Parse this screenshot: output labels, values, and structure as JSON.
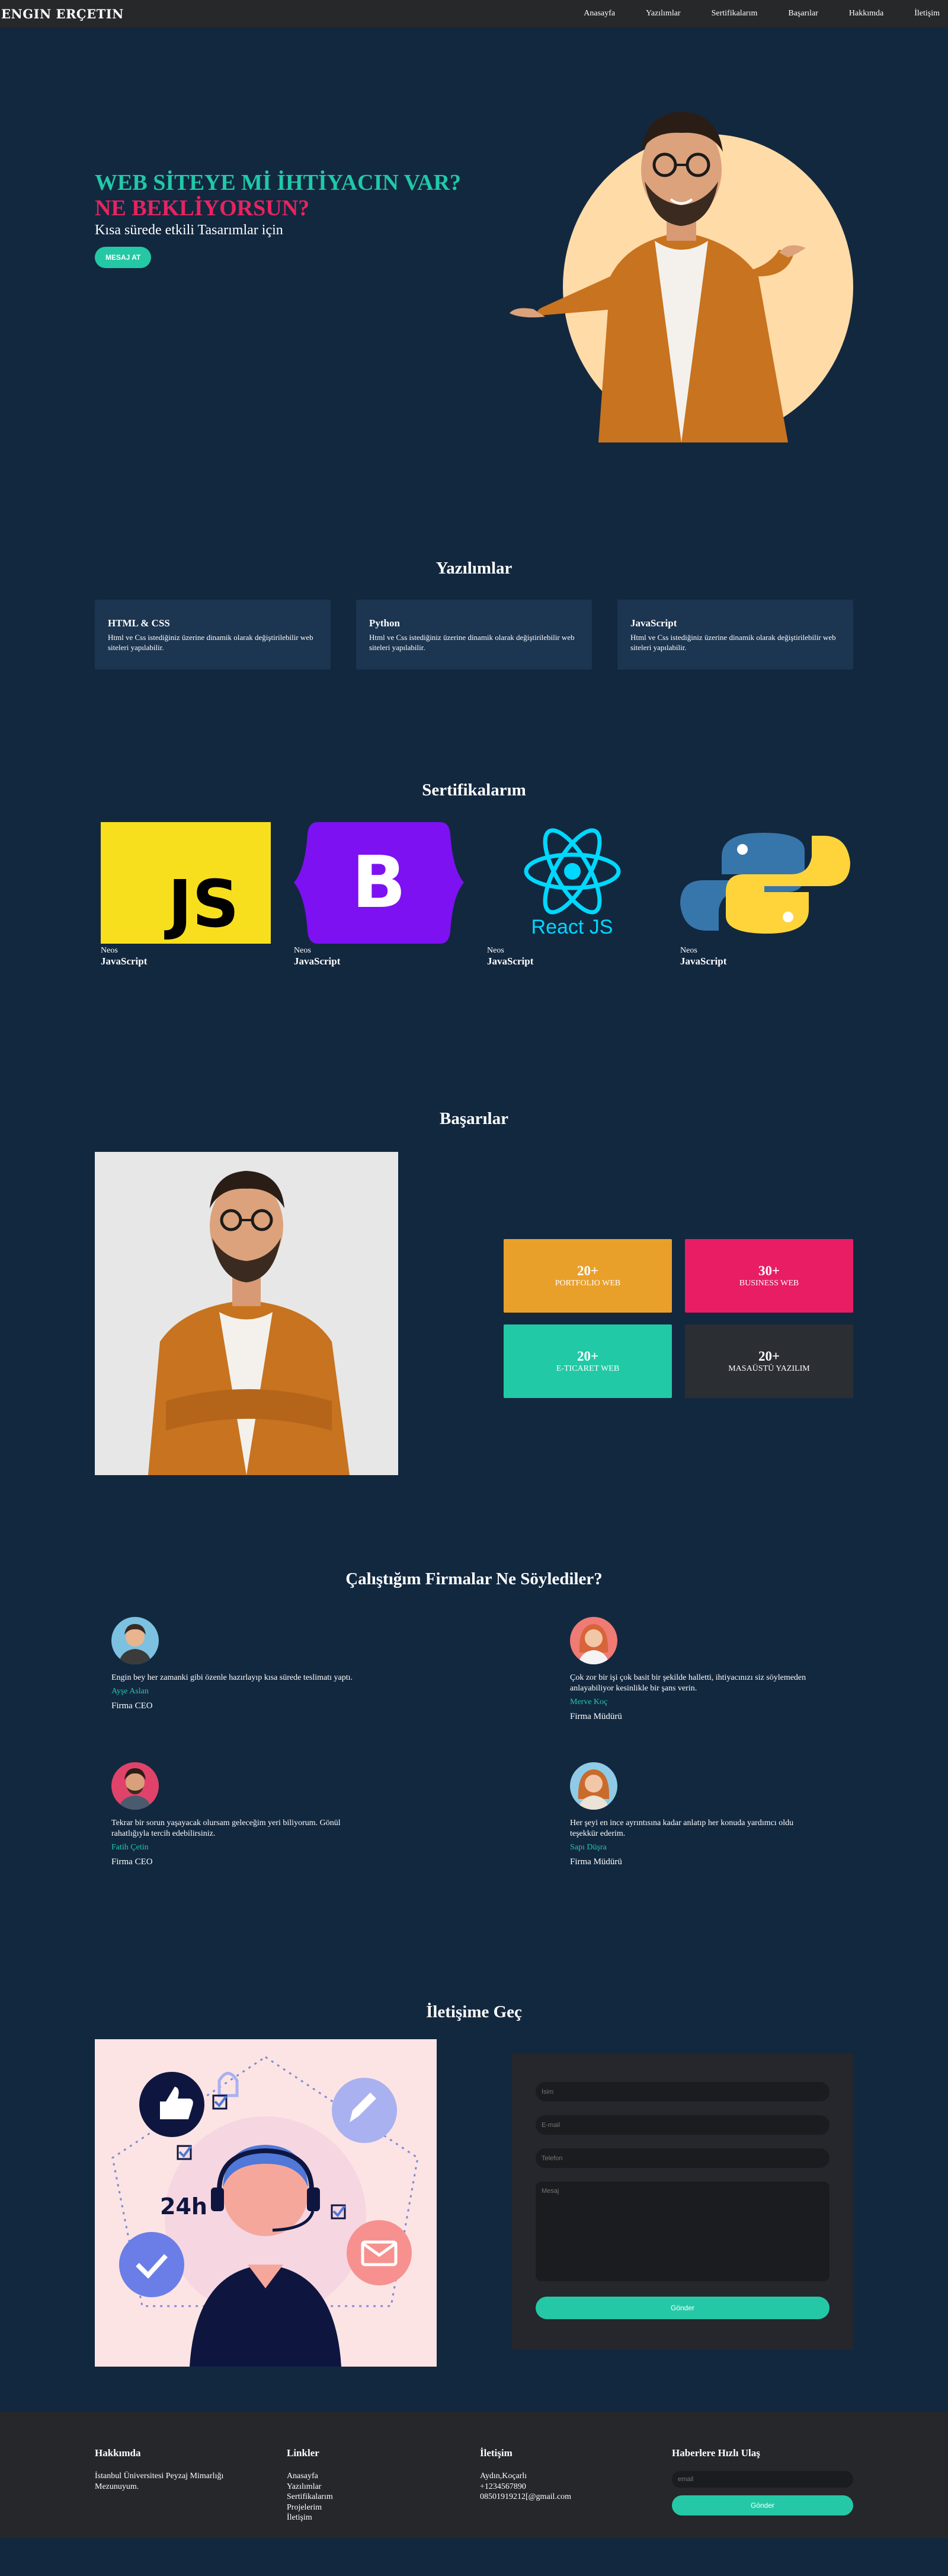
{
  "nav": {
    "brand": "ENGIN ERÇETIN",
    "links": [
      "Anasayfa",
      "Yazılımlar",
      "Sertifikalarım",
      "Başarılar",
      "Hakkımda",
      "İletişim"
    ]
  },
  "hero": {
    "line1": "WEB SİTEYE Mİ İHTİYACIN VAR?",
    "line2": "NE BEKLİYORSUN?",
    "subtitle": "Kısa sürede etkili Tasarımlar için",
    "button": "MESAJ AT"
  },
  "software": {
    "title": "Yazılımlar",
    "cards": [
      {
        "title": "HTML & CSS",
        "text": "Html ve Css istediğiniz üzerine dinamik olarak değiştirilebilir web siteleri yapılabilir."
      },
      {
        "title": "Python",
        "text": "Html ve Css istediğiniz üzerine dinamik olarak değiştirilebilir web siteleri yapılabilir."
      },
      {
        "title": "JavaScript",
        "text": "Html ve Css istediğiniz üzerine dinamik olarak değiştirilebilir web siteleri yapılabilir."
      }
    ]
  },
  "certificates": {
    "title": "Sertifikalarım",
    "items": [
      {
        "logo": "javascript-logo",
        "logo_text": "JS",
        "sub": "Neos",
        "name": "JavaScript"
      },
      {
        "logo": "bootstrap-logo",
        "logo_text": "B",
        "sub": "Neos",
        "name": "JavaScript"
      },
      {
        "logo": "react-logo",
        "logo_text": "React JS",
        "sub": "Neos",
        "name": "JavaScript"
      },
      {
        "logo": "python-logo",
        "logo_text": "",
        "sub": "Neos",
        "name": "JavaScript"
      }
    ]
  },
  "success": {
    "title": "Başarılar",
    "stats": [
      {
        "num": "20+",
        "label": "PORTFOLIO WEB",
        "color": "#e9a02a"
      },
      {
        "num": "30+",
        "label": "BUSINESS WEB",
        "color": "#e81d63"
      },
      {
        "num": "20+",
        "label": "E-TICARET WEB",
        "color": "#22c9a6"
      },
      {
        "num": "20+",
        "label": "MASAÜSTÜ YAZILIM",
        "color": "#2b2e33"
      }
    ]
  },
  "testimonials": {
    "title": "Çalıştığım Firmalar Ne Söylediler?",
    "items": [
      {
        "quote": "Engin bey her zamanki gibi özenle hazırlayıp kısa sürede teslimatı yaptı.",
        "name": "Ayşe Aslan",
        "role": "Firma CEO",
        "avatar_bg": "#7cc1e0"
      },
      {
        "quote": "Çok zor bir işi çok basit bir şekilde halletti, ihtiyacınızı siz söylemeden anlayabiliyor kesinlikle bir şans verin.",
        "name": "Merve Koç",
        "role": "Firma Müdürü",
        "avatar_bg": "#f07a74"
      },
      {
        "quote": "Tekrar bir sorun yaşayacak olursam geleceğim yeri biliyorum. Gönül rahatlığıyla tercih edebilirsiniz.",
        "name": "Fatih Çetin",
        "role": "Firma CEO",
        "avatar_bg": "#e0436a"
      },
      {
        "quote": "Her şeyi en ince ayrıntısına kadar anlatıp her konuda yardımcı oldu teşekkür ederim.",
        "name": "Sapı Düşra",
        "role": "Firma Müdürü",
        "avatar_bg": "#8fcbe6"
      }
    ]
  },
  "contact": {
    "title": "İletişime Geç",
    "illus_text": "24h",
    "name_placeholder": "İsim",
    "email_placeholder": "E-mail",
    "phone_placeholder": "Telefon",
    "message_placeholder": "Mesaj",
    "button": "Gönder"
  },
  "footer": {
    "about_title": "Hakkımda",
    "about_text": "İstanbul Üniversitesi Peyzaj Mimarlığı Mezunuyum.",
    "links_title": "Linkler",
    "links": [
      "Anasayfa",
      "Yazılımlar",
      "Sertifikalarım",
      "Projelerim",
      "İletişim"
    ],
    "contact_title": "İletişim",
    "contact_lines": [
      "Aydın,Koçarlı",
      "+1234567890",
      "08501919212[@gmail.com"
    ],
    "news_title": "Haberlere Hızlı Ulaş",
    "email_placeholder": "email",
    "button": "Gönder"
  }
}
